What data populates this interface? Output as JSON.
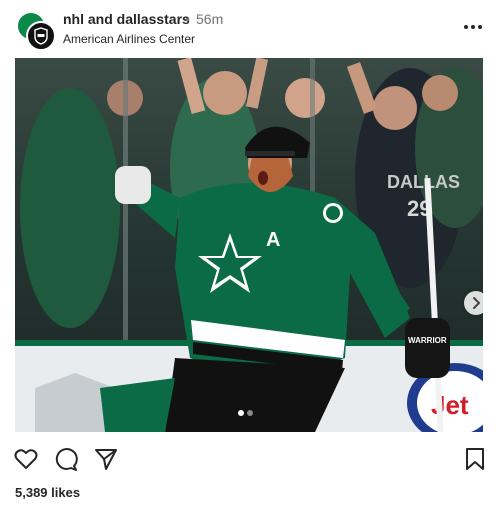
{
  "post": {
    "account": "nhl and dallasstars",
    "separator": "•",
    "time": "56m",
    "location": "American Airlines Center",
    "likes": "5,389 likes"
  },
  "photo": {
    "jersey_letter": "A",
    "sign_text": "Jet"
  },
  "icons": {
    "heart": "heart-icon",
    "comment": "comment-icon",
    "share": "share-icon",
    "save": "bookmark-icon",
    "more": "more-icon",
    "next": "chevron-right-icon"
  },
  "carousel": {
    "count": 2,
    "active": 1
  },
  "colors": {
    "stars_green": "#0b6b46",
    "dark": "#262626",
    "muted": "#737373"
  }
}
